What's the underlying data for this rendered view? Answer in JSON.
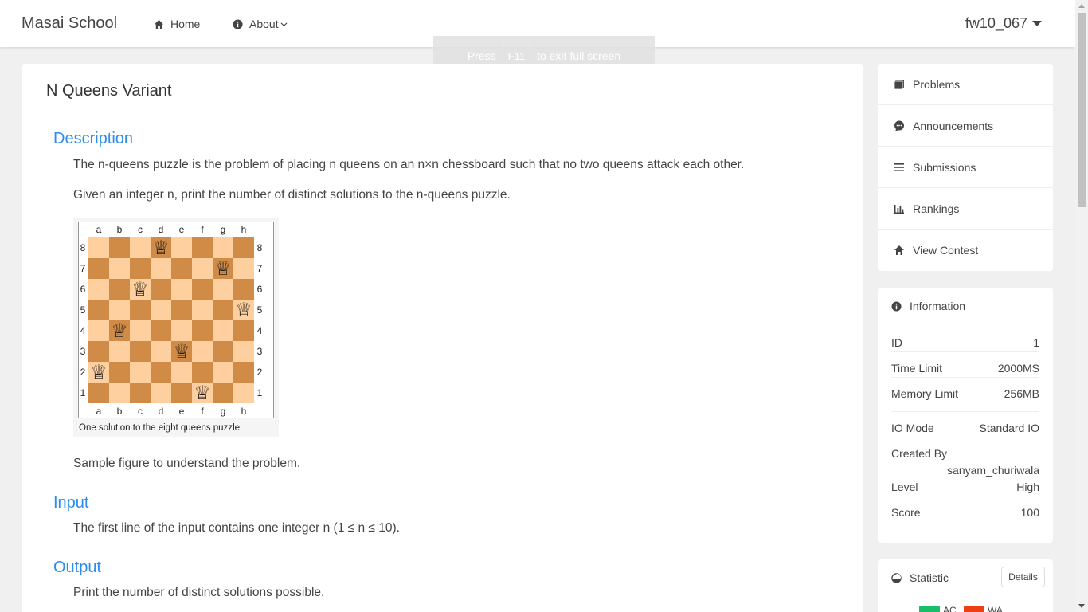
{
  "navbar": {
    "brand": "Masai School",
    "home_label": "Home",
    "about_label": "About",
    "username": "fw10_067"
  },
  "fullscreen_notice": {
    "before": "Press",
    "key": "F11",
    "after": "to exit full screen"
  },
  "problem": {
    "title": "N Queens Variant",
    "description_heading": "Description",
    "description_p1": "The n-queens puzzle is the problem of placing n queens on an n×n chessboard such that no two queens attack each other.",
    "description_p2": "Given an integer n, print the number of distinct solutions to the n-queens puzzle.",
    "figure_caption": "One solution to the eight queens puzzle",
    "description_p3": "Sample figure to understand the problem.",
    "input_heading": "Input",
    "input_text": "The first line of the input contains one integer n (1 ≤ n ≤ 10).",
    "output_heading": "Output",
    "output_text": "Print the number of distinct solutions possible."
  },
  "board": {
    "files": [
      "a",
      "b",
      "c",
      "d",
      "e",
      "f",
      "g",
      "h"
    ],
    "ranks": [
      "8",
      "7",
      "6",
      "5",
      "4",
      "3",
      "2",
      "1"
    ],
    "queens": [
      "d8",
      "g7",
      "c6",
      "h5",
      "b4",
      "e3",
      "a2",
      "f1"
    ],
    "queen_glyph": "♕",
    "light_color": "#fecf9f",
    "dark_color": "#d08c47"
  },
  "sidebar": {
    "menu": [
      {
        "label": "Problems",
        "icon": "book-icon"
      },
      {
        "label": "Announcements",
        "icon": "chat-icon"
      },
      {
        "label": "Submissions",
        "icon": "list-icon"
      },
      {
        "label": "Rankings",
        "icon": "bar-chart-icon"
      },
      {
        "label": "View Contest",
        "icon": "home-icon"
      }
    ],
    "information": {
      "heading": "Information",
      "id_label": "ID",
      "id_value": "1",
      "time_label": "Time Limit",
      "time_value": "2000MS",
      "memory_label": "Memory Limit",
      "memory_value": "256MB",
      "io_label": "IO Mode",
      "io_value": "Standard IO",
      "created_label": "Created By",
      "created_value": "sanyam_churiwala",
      "level_label": "Level",
      "level_value": "High",
      "score_label": "Score",
      "score_value": "100"
    },
    "statistic": {
      "heading": "Statistic",
      "details_label": "Details",
      "legend_ac": "AC",
      "legend_wa": "WA",
      "ac_color": "#19be6b",
      "wa_color": "#ed3f14"
    }
  },
  "colors": {
    "accent": "#2d8cf0",
    "background": "#f0f0f0"
  }
}
